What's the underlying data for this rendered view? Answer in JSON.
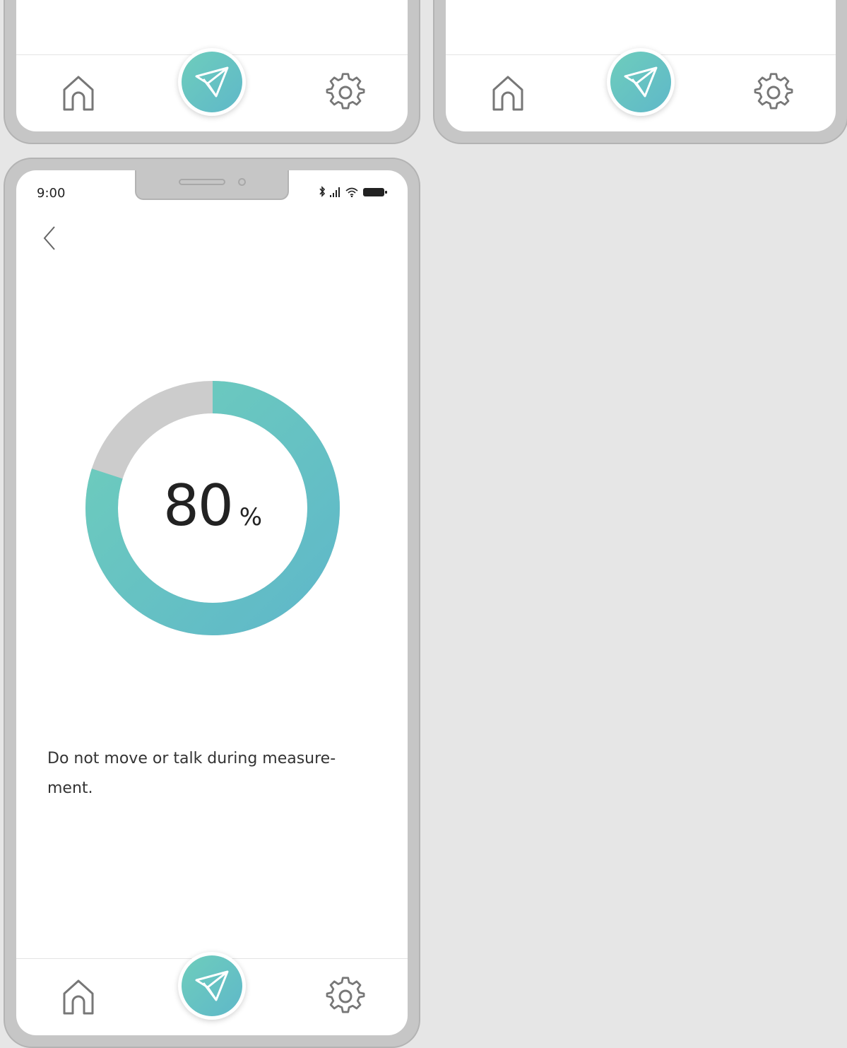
{
  "colors": {
    "accent_start": "#6ecdbc",
    "accent_end": "#5fb8c9",
    "ring_track": "#cccccc",
    "frame": "#c6c6c6",
    "background": "#e6e6e6"
  },
  "nav": {
    "home_icon": "home-icon",
    "measure_icon": "paper-plane-icon",
    "settings_icon": "gear-icon"
  },
  "status_bar": {
    "time": "9:00",
    "icons": [
      "bluetooth-icon",
      "signal-icon",
      "wifi-icon",
      "battery-icon"
    ]
  },
  "measurement": {
    "progress": 0.8,
    "value": "80",
    "unit": "%",
    "instruction": "Do not move or talk during measure-ment."
  }
}
